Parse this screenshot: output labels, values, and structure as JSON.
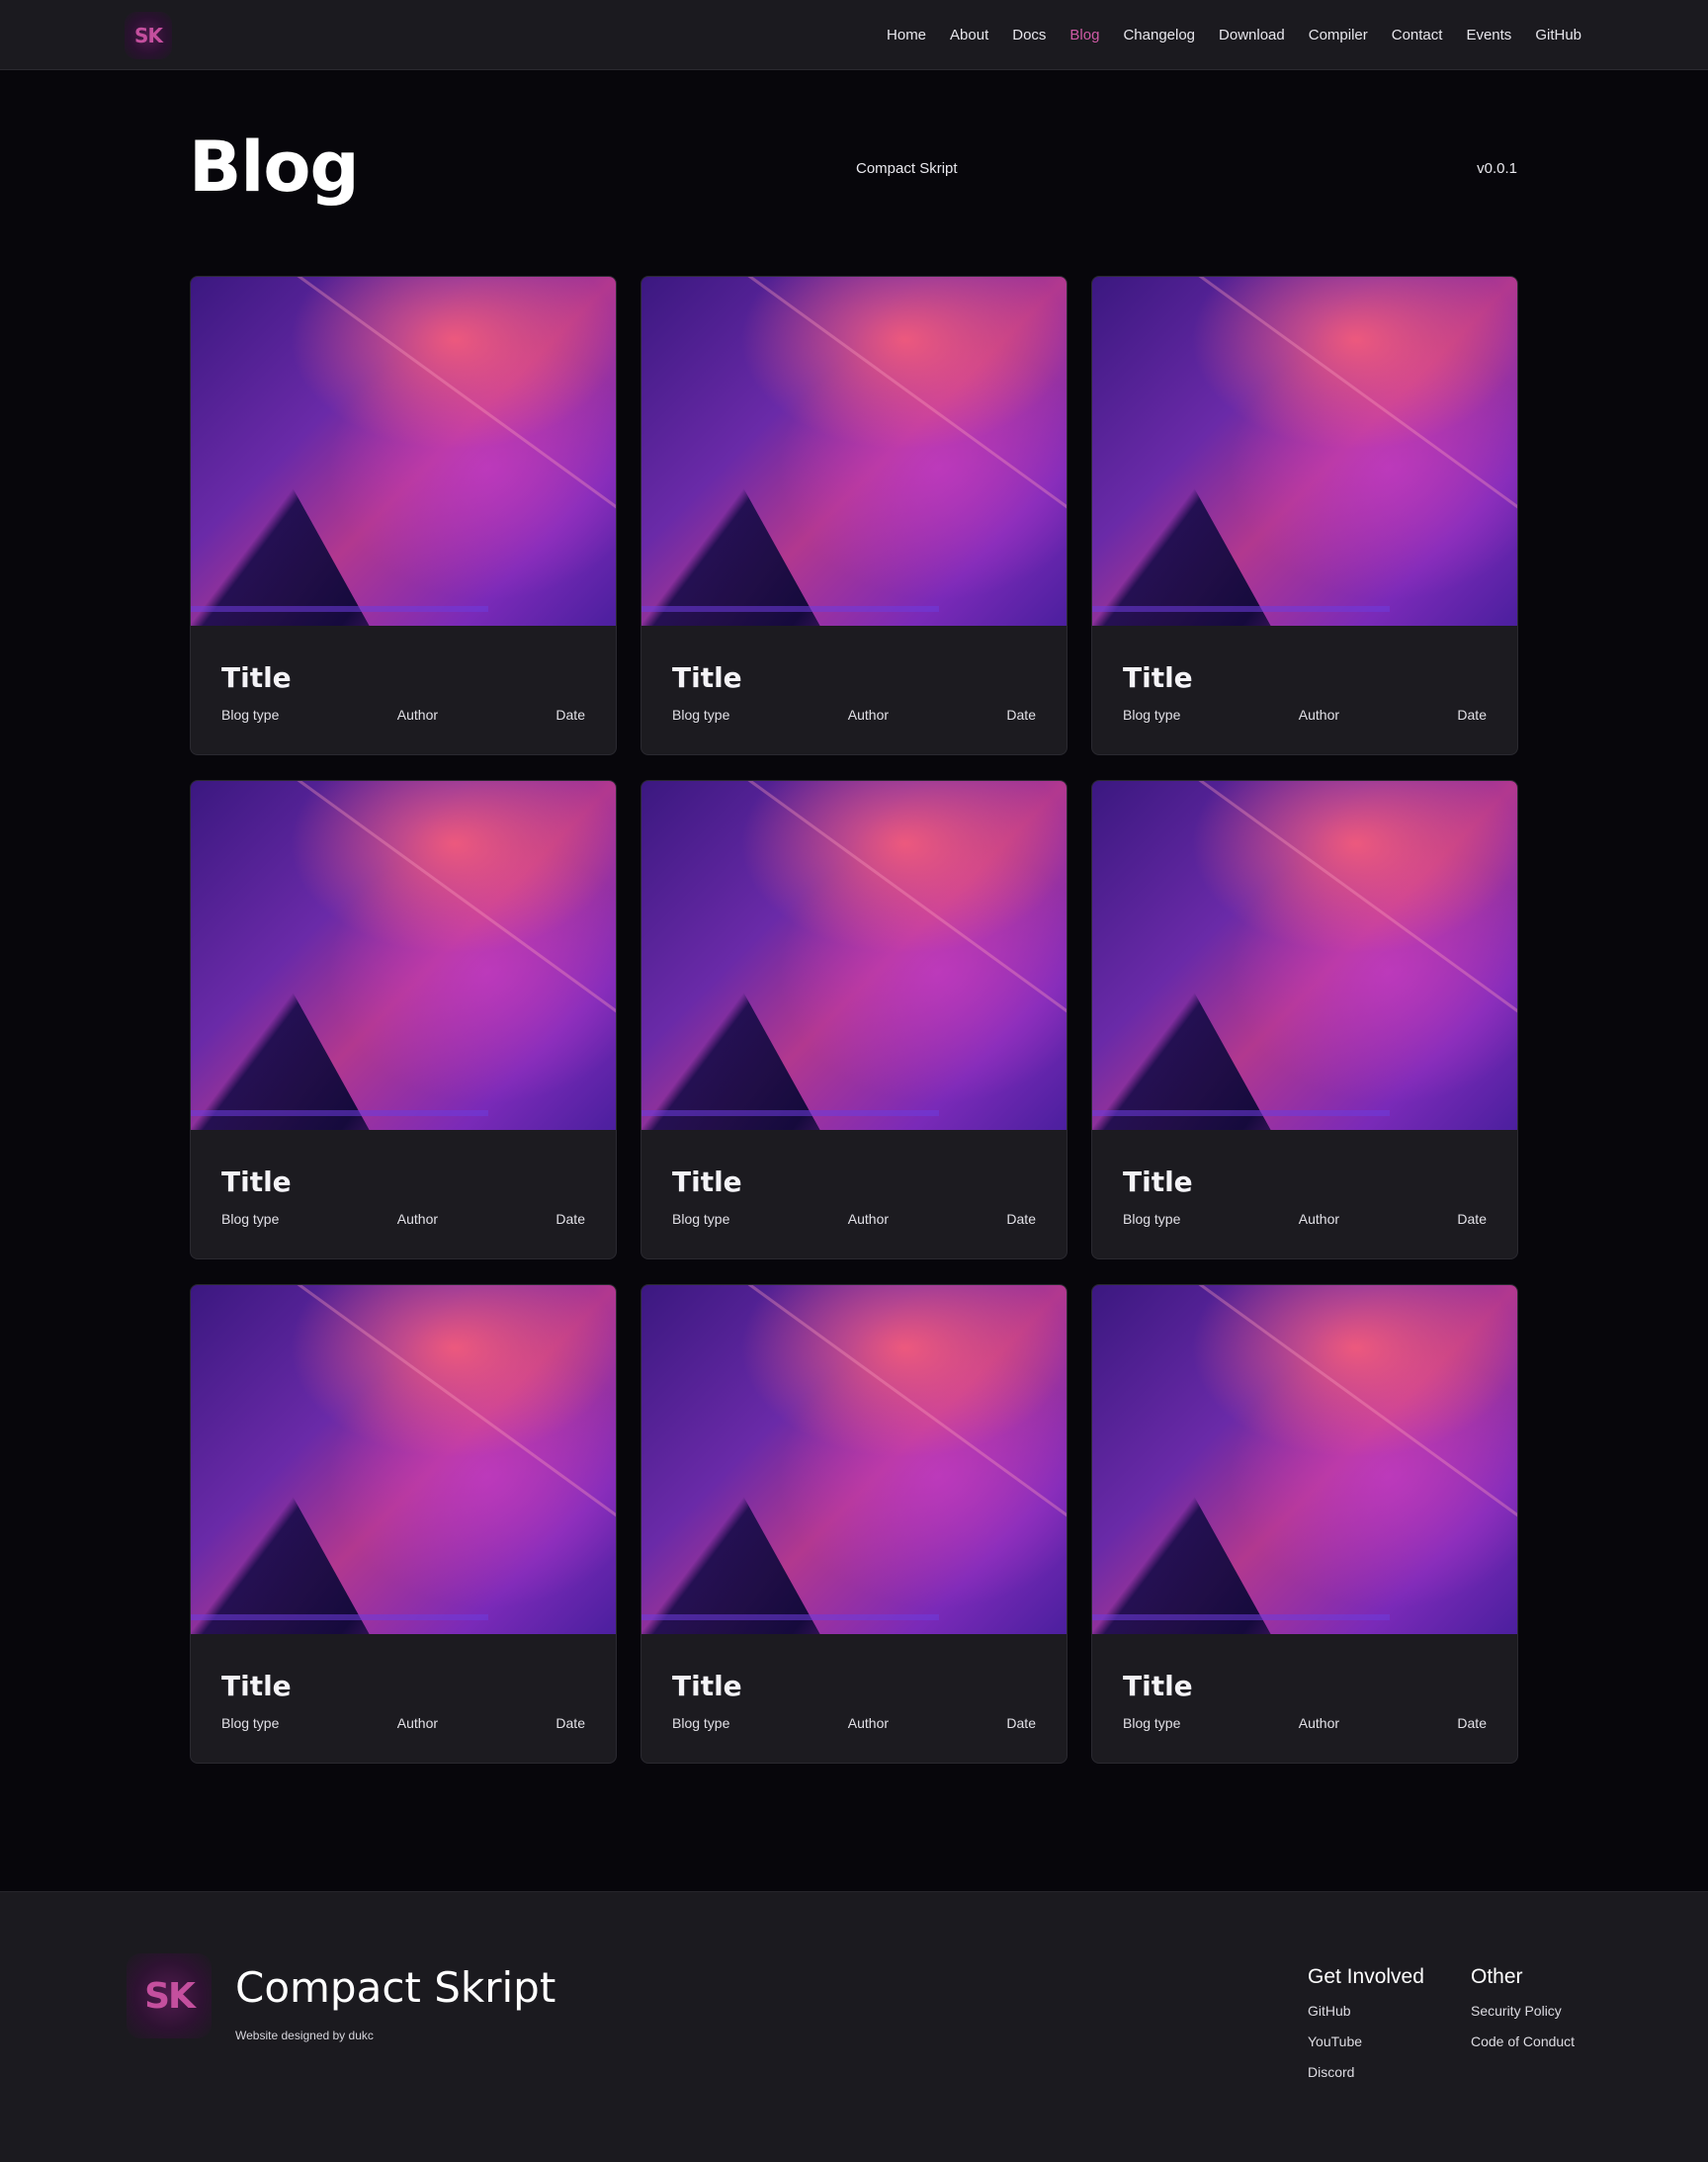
{
  "nav": {
    "logo_text": "SK",
    "links": [
      {
        "label": "Home"
      },
      {
        "label": "About"
      },
      {
        "label": "Docs"
      },
      {
        "label": "Blog"
      },
      {
        "label": "Changelog"
      },
      {
        "label": "Download"
      },
      {
        "label": "Compiler"
      },
      {
        "label": "Contact"
      },
      {
        "label": "Events"
      },
      {
        "label": "GitHub"
      }
    ],
    "active_label": "Blog",
    "active_color": "#cf5aa6"
  },
  "header": {
    "title": "Blog",
    "subtitle": "Compact Skript",
    "version": "v0.0.1"
  },
  "posts": [
    {
      "title": "Title",
      "type": "Blog type",
      "author": "Author",
      "date": "Date"
    },
    {
      "title": "Title",
      "type": "Blog type",
      "author": "Author",
      "date": "Date"
    },
    {
      "title": "Title",
      "type": "Blog type",
      "author": "Author",
      "date": "Date"
    },
    {
      "title": "Title",
      "type": "Blog type",
      "author": "Author",
      "date": "Date"
    },
    {
      "title": "Title",
      "type": "Blog type",
      "author": "Author",
      "date": "Date"
    },
    {
      "title": "Title",
      "type": "Blog type",
      "author": "Author",
      "date": "Date"
    },
    {
      "title": "Title",
      "type": "Blog type",
      "author": "Author",
      "date": "Date"
    },
    {
      "title": "Title",
      "type": "Blog type",
      "author": "Author",
      "date": "Date"
    },
    {
      "title": "Title",
      "type": "Blog type",
      "author": "Author",
      "date": "Date"
    }
  ],
  "footer": {
    "logo_text": "SK",
    "brand": "Compact Skript",
    "credit": "Website designed by dukc",
    "columns": [
      {
        "heading": "Get Involved",
        "links": [
          "GitHub",
          "YouTube",
          "Discord"
        ]
      },
      {
        "heading": "Other",
        "links": [
          "Security Policy",
          "Code of Conduct"
        ]
      }
    ]
  },
  "colors": {
    "background": "#07060b",
    "surface": "#1c1b20",
    "accent": "#cf5aa6"
  }
}
